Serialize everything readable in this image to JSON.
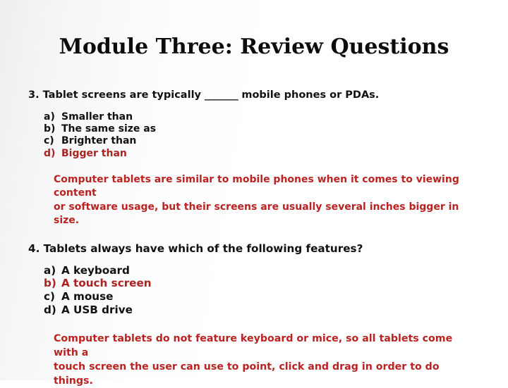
{
  "slide": {
    "title": "Module Three: Review Questions",
    "colors": {
      "text": "#111111",
      "title": "#0d0d0d",
      "correct_answer": "#aa2222",
      "explanation": "#bb2222",
      "background": "#ffffff",
      "background_edge": "#ededed"
    }
  },
  "questions": [
    {
      "number": "3.",
      "stem_before_blank": "3. Tablet screens are typically ",
      "blank": "_______",
      "stem_after_blank": " mobile phones or PDAs.",
      "options": [
        {
          "marker": "a)",
          "label": "Smaller than",
          "correct": false
        },
        {
          "marker": "b)",
          "label": "The same size as",
          "correct": false
        },
        {
          "marker": "c)",
          "label": "Brighter than",
          "correct": false
        },
        {
          "marker": "d)",
          "label": "Bigger than",
          "correct": true
        }
      ],
      "explanation_line1": "Computer tablets are similar to mobile phones when it comes to viewing content",
      "explanation_line2": "or software usage, but their screens are usually several inches bigger in size."
    },
    {
      "number": "4.",
      "stem": "4. Tablets always have which of the following features?",
      "options": [
        {
          "marker": "a)",
          "label": "A keyboard",
          "correct": false
        },
        {
          "marker": "b)",
          "label": "A touch screen",
          "correct": true
        },
        {
          "marker": "c)",
          "label": "A mouse",
          "correct": false
        },
        {
          "marker": "d)",
          "label": "A USB drive",
          "correct": false
        }
      ],
      "explanation_line1": "Computer tablets do not feature keyboard or mice, so all tablets come with a",
      "explanation_line2": "touch screen the user can use to point, click and drag in order to do things."
    }
  ]
}
